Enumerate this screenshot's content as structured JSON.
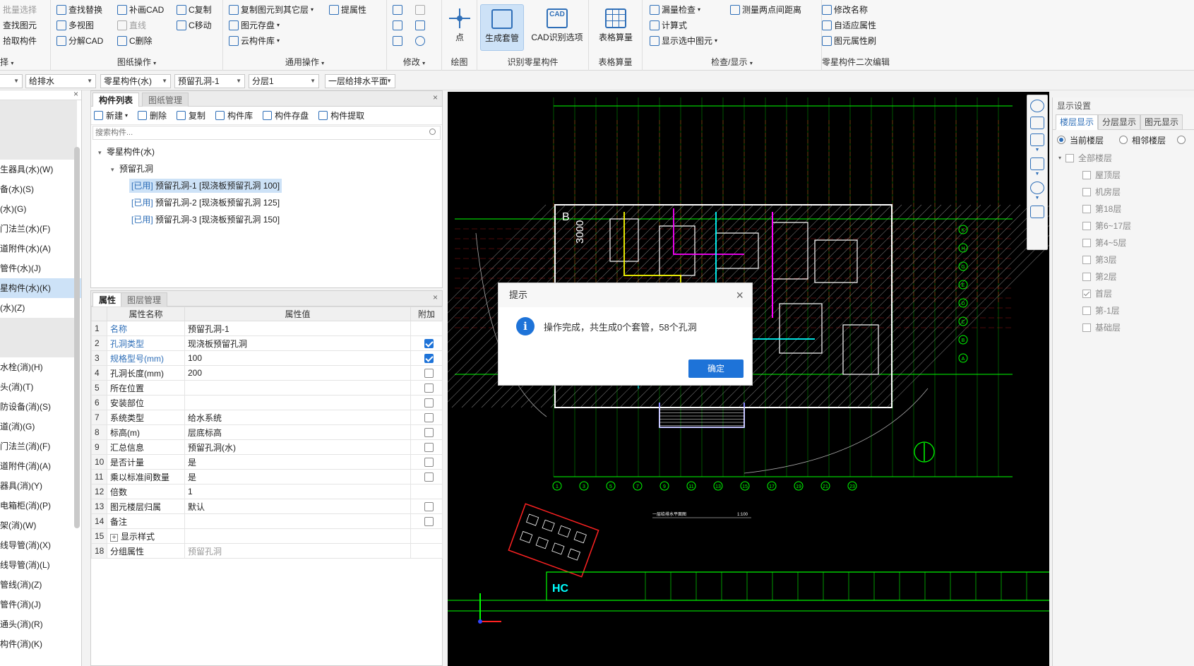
{
  "ribbon": {
    "col1": [
      "批量选择",
      "查找图元",
      "拾取构件"
    ],
    "col1_label_partial": "择",
    "drawing_ops": {
      "items": [
        "查找替换",
        "补画CAD",
        "C复制",
        "多视图",
        "直线",
        "C移动",
        "分解CAD",
        "C删除"
      ],
      "label": "图纸操作"
    },
    "general_ops": {
      "items": [
        "复制图元到其它层",
        "提属性",
        "图元存盘",
        "云构件库"
      ],
      "label": "通用操作"
    },
    "modify": {
      "label": "修改"
    },
    "draw": {
      "point": "点",
      "label": "绘图"
    },
    "identify": {
      "generate": "生成套管",
      "cad_option": "CAD识别选项",
      "label": "识别零星构件",
      "cad_icon_text": "CAD"
    },
    "table_calc": {
      "btn": "表格算量",
      "label": "表格算量"
    },
    "check": {
      "items": [
        "漏量检查",
        "测量两点间距离",
        "计算式",
        "显示选中图元"
      ],
      "label": "检查/显示"
    },
    "secondary_edit": {
      "items": [
        "修改名称",
        "自适应属性",
        "图元属性刷"
      ],
      "label": "零星构件二次编辑"
    }
  },
  "filters": [
    "",
    "给排水",
    "零星构件(水)",
    "预留孔洞-1",
    "分层1",
    "一层给排水平面"
  ],
  "left_panel": {
    "items": [
      "",
      "",
      "",
      "生器具(水)(W)",
      "备(水)(S)",
      "(水)(G)",
      "门法兰(水)(F)",
      "道附件(水)(A)",
      "管件(水)(J)",
      "星构件(水)(K)",
      "(水)(Z)",
      "",
      "",
      "水栓(消)(H)",
      "头(消)(T)",
      "防设备(消)(S)",
      "道(消)(G)",
      "门法兰(消)(F)",
      "道附件(消)(A)",
      "器具(消)(Y)",
      "电箱柜(消)(P)",
      "架(消)(W)",
      "线导管(消)(X)",
      "线导管(消)(L)",
      "管线(消)(Z)",
      "管件(消)(J)",
      "通头(消)(R)",
      "构件(消)(K)"
    ]
  },
  "comp_list": {
    "tabs": [
      "构件列表",
      "图纸管理"
    ],
    "toolbar": [
      "新建",
      "删除",
      "复制",
      "构件库",
      "构件存盘",
      "构件提取"
    ],
    "search_placeholder": "搜索构件...",
    "tree": {
      "root": "零星构件(水)",
      "group": "预留孔洞",
      "leaves": [
        {
          "tag": "[已用]",
          "text": "预留孔洞-1 [现浇板预留孔洞 100]"
        },
        {
          "tag": "[已用]",
          "text": "预留孔洞-2 [现浇板预留孔洞 125]"
        },
        {
          "tag": "[已用]",
          "text": "预留孔洞-3 [现浇板预留孔洞 150]"
        }
      ]
    }
  },
  "props": {
    "tabs": [
      "属性",
      "图层管理"
    ],
    "headers": [
      "",
      "属性名称",
      "属性值",
      "附加"
    ],
    "rows": [
      {
        "n": "1",
        "name": "名称",
        "value": "预留孔洞-1",
        "blue": true,
        "cb": null
      },
      {
        "n": "2",
        "name": "孔洞类型",
        "value": "现浇板预留孔洞",
        "blue": true,
        "cb": true
      },
      {
        "n": "3",
        "name": "规格型号(mm)",
        "value": "100",
        "blue": true,
        "cb": true
      },
      {
        "n": "4",
        "name": "孔洞长度(mm)",
        "value": "200",
        "blue": false,
        "cb": false
      },
      {
        "n": "5",
        "name": "所在位置",
        "value": "",
        "blue": false,
        "cb": false
      },
      {
        "n": "6",
        "name": "安装部位",
        "value": "",
        "blue": false,
        "cb": false
      },
      {
        "n": "7",
        "name": "系统类型",
        "value": "给水系统",
        "blue": false,
        "cb": false
      },
      {
        "n": "8",
        "name": "标高(m)",
        "value": "层底标高",
        "blue": false,
        "cb": false
      },
      {
        "n": "9",
        "name": "汇总信息",
        "value": "预留孔洞(水)",
        "blue": false,
        "cb": false
      },
      {
        "n": "10",
        "name": "是否计量",
        "value": "是",
        "blue": false,
        "cb": false
      },
      {
        "n": "11",
        "name": "乘以标准间数量",
        "value": "是",
        "blue": false,
        "cb": false
      },
      {
        "n": "12",
        "name": "倍数",
        "value": "1",
        "blue": false,
        "cb": null
      },
      {
        "n": "13",
        "name": "图元楼层归属",
        "value": "默认",
        "blue": false,
        "cb": false
      },
      {
        "n": "14",
        "name": "备注",
        "value": "",
        "blue": false,
        "cb": false
      },
      {
        "n": "15",
        "name": "显示样式",
        "value": "",
        "blue": false,
        "cb": null,
        "expand": "+"
      },
      {
        "n": "18",
        "name": "分组属性",
        "value": "预留孔洞",
        "blue": false,
        "cb": null,
        "gray": true
      }
    ]
  },
  "cad": {
    "axis_letters": [
      "K",
      "H",
      "G",
      "E",
      "D",
      "C",
      "B",
      "A"
    ],
    "axis_numbers": [
      "1",
      "3",
      "5",
      "7",
      "9",
      "11",
      "13",
      "15",
      "17",
      "19",
      "21",
      "23"
    ],
    "block_letter": "B",
    "dim_text": "3000",
    "drawing_title": "一层给排水平面图",
    "scale": "1:100",
    "logo": "HC"
  },
  "display": {
    "title": "显示设置",
    "tabs": [
      "楼层显示",
      "分层显示",
      "图元显示"
    ],
    "radios": [
      "当前楼层",
      "相邻楼层"
    ],
    "root": "全部楼层",
    "floors": [
      {
        "name": "屋顶层",
        "checked": false
      },
      {
        "name": "机房层",
        "checked": false
      },
      {
        "name": "第18层",
        "checked": false
      },
      {
        "name": "第6~17层",
        "checked": false
      },
      {
        "name": "第4~5层",
        "checked": false
      },
      {
        "name": "第3层",
        "checked": false
      },
      {
        "name": "第2层",
        "checked": false
      },
      {
        "name": "首层",
        "checked": true
      },
      {
        "name": "第-1层",
        "checked": false
      },
      {
        "name": "基础层",
        "checked": false
      }
    ]
  },
  "dialog": {
    "title": "提示",
    "message": "操作完成，共生成0个套管，58个孔洞",
    "ok": "确定",
    "info_glyph": "i",
    "close_glyph": "×"
  }
}
